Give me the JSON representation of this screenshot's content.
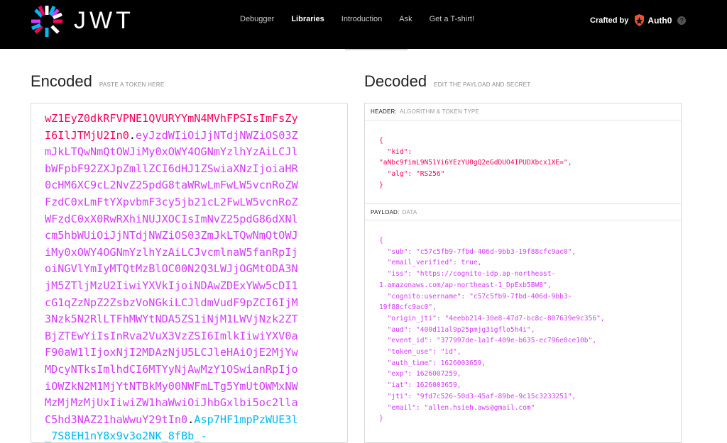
{
  "header": {
    "logo_text": "JWT",
    "nav": [
      "Debugger",
      "Libraries",
      "Introduction",
      "Ask",
      "Get a T-shirt!"
    ],
    "active_nav": "Libraries",
    "crafted_by": "Crafted by",
    "brand": "Auth0",
    "help": "?"
  },
  "encoded": {
    "title": "Encoded",
    "subtitle": "PASTE A TOKEN HERE",
    "lines": [
      {
        "parts": [
          {
            "t": "wZ1EyZ0dkRFVPNE1QVURYYmN4MVhFPSIsImFsZy",
            "c": "c-header"
          }
        ]
      },
      {
        "parts": [
          {
            "t": "I6IlJTMjU2In0",
            "c": "c-header"
          },
          {
            "t": ".",
            "c": "c-dot"
          },
          {
            "t": "eyJzdWIiOiJjNTdjNWZiOS03Z",
            "c": "c-payload"
          }
        ]
      },
      {
        "parts": [
          {
            "t": "mJkLTQwNmQtOWJiMy0xOWY4OGNmYzlhYzAiLCJl",
            "c": "c-payload"
          }
        ]
      },
      {
        "parts": [
          {
            "t": "bWFpbF92ZXJpZmllZCI6dHJ1ZSwiaXNzIjoiaHR",
            "c": "c-payload"
          }
        ]
      },
      {
        "parts": [
          {
            "t": "0cHM6XC9cL2NvZ25pdG8taWRwLmFwLW5vcnRoZW",
            "c": "c-payload"
          }
        ]
      },
      {
        "parts": [
          {
            "t": "FzdC0xLmFtYXpvbmF3cy5jb21cL2FwLW5vcnRoZ",
            "c": "c-payload"
          }
        ]
      },
      {
        "parts": [
          {
            "t": "WFzdC0xX0RwRXhiNUJXOCIsImNvZ25pdG86dXNl",
            "c": "c-payload"
          }
        ]
      },
      {
        "parts": [
          {
            "t": "cm5hbWUiOiJjNTdjNWZiOS03ZmJkLTQwNmQtOWJ",
            "c": "c-payload"
          }
        ]
      },
      {
        "parts": [
          {
            "t": "iMy0xOWY4OGNmYzlhYzAiLCJvcmlnaW5fanRpIj",
            "c": "c-payload"
          }
        ]
      },
      {
        "parts": [
          {
            "t": "oiNGVlYmIyMTQtMzBlOC00N2Q3LWJjOGMtODA3N",
            "c": "c-payload"
          }
        ]
      },
      {
        "parts": [
          {
            "t": "jM5ZTljMzU2IiwiYXVkIjoiNDAwZDExYWw5cDI1",
            "c": "c-payload"
          }
        ]
      },
      {
        "parts": [
          {
            "t": "cG1qZzNpZ2ZsbzVoNGkiLCJldmVudF9pZCI6IjM",
            "c": "c-payload"
          }
        ]
      },
      {
        "parts": [
          {
            "t": "3Nzk5N2RlLTFhMWYtNDA5ZS1iNjM1LWVjNzk2ZT",
            "c": "c-payload"
          }
        ]
      },
      {
        "parts": [
          {
            "t": "BjZTEwYiIsInRva2VuX3VzZSI6ImlkIiwiYXV0a",
            "c": "c-payload"
          }
        ]
      },
      {
        "parts": [
          {
            "t": "F90aW1lIjoxNjI2MDAzNjU5LCJleHAiOjE2MjYw",
            "c": "c-payload"
          }
        ]
      },
      {
        "parts": [
          {
            "t": "MDcyNTksImlhdCI6MTYyNjAwMzY1OSwianRpIjo",
            "c": "c-payload"
          }
        ]
      },
      {
        "parts": [
          {
            "t": "iOWZkN2M1MjYtNTBkMy00NWFmLTg5YmUtOWMxNW",
            "c": "c-payload"
          }
        ]
      },
      {
        "parts": [
          {
            "t": "MzMjMzMjUxIiwiZW1haWwiOiJhbGxlbi5oc2lla",
            "c": "c-payload"
          }
        ]
      },
      {
        "parts": [
          {
            "t": "C5hd3NAZ21haWwuY29tIn0",
            "c": "c-payload"
          },
          {
            "t": ".",
            "c": "c-dot"
          },
          {
            "t": "Asp7HF1mpPzWUE3l",
            "c": "c-sig"
          }
        ]
      },
      {
        "parts": [
          {
            "t": "_7S8EH1nY8x9v3o2NK_8fBb_-",
            "c": "c-sig"
          }
        ]
      }
    ]
  },
  "decoded": {
    "title": "Decoded",
    "subtitle": "EDIT THE PAYLOAD AND SECRET",
    "header_label": "HEADER:",
    "header_sub": "ALGORITHM & TOKEN TYPE",
    "header_lines": [
      "{",
      "  \"kid\":",
      "\"aNbc9fimL9N51Yi6YEzYU0gQ2eGdDUO4IPUDXbcx1XE=\",",
      "  \"alg\": \"RS256\"",
      "}"
    ],
    "payload_label": "PAYLOAD:",
    "payload_sub": "DATA",
    "payload_lines": [
      "{",
      "  \"sub\": \"c57c5fb9-7fbd-406d-9bb3-19f88cfc9ac0\",",
      "  \"email_verified\": true,",
      "  \"iss\": \"https://cognito-idp.ap-northeast-",
      "1.amazonaws.com/ap-northeast-1_DpExb5BW8\",",
      "  \"cognito:username\": \"c57c5fb9-7fbd-406d-9bb3-",
      "19f88cfc9ac0\",",
      "  \"origin_jti\": \"4eebb214-30e8-47d7-bc8c-807639e9c356\",",
      "  \"aud\": \"400d11al9p25pmjg3igflo5h4i\",",
      "  \"event_id\": \"377997de-1a1f-409e-b635-ec796e0ce10b\",",
      "  \"token_use\": \"id\",",
      "  \"auth_time\": 1626003659,",
      "  \"exp\": 1626007259,",
      "  \"iat\": 1626003659,",
      "  \"jti\": \"9fd7c526-50d3-45af-89be-9c15c3233251\",",
      "  \"email\": \"allen.hsieh.aws@gmail.com\"",
      "}"
    ]
  }
}
